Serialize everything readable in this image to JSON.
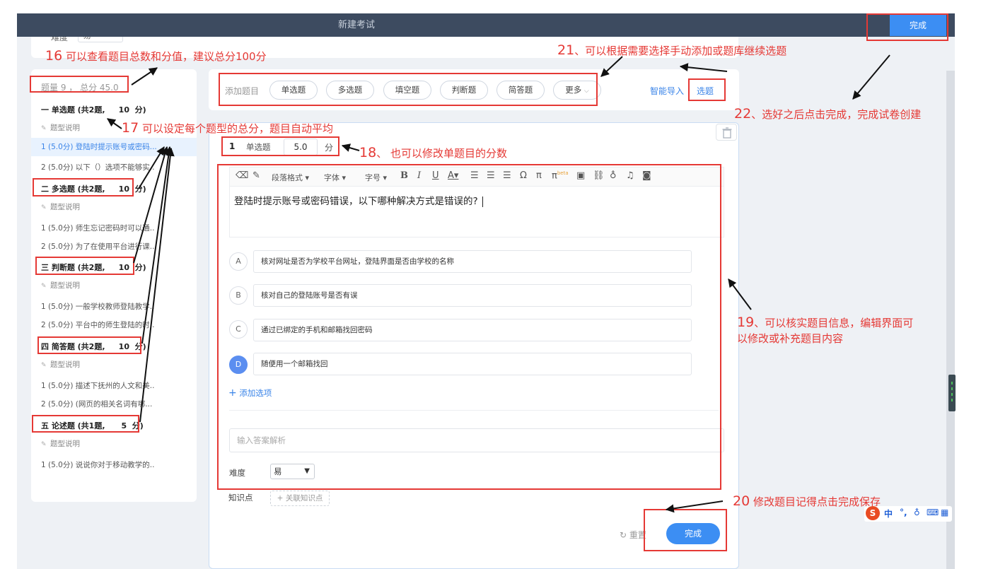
{
  "window": {
    "title": "新建考试",
    "done_label": "完成"
  },
  "prev_panel": {
    "difficulty_label": "难度",
    "difficulty_value": "易"
  },
  "sidebar": {
    "summary": "题量 9 ， 总分 45.0",
    "type_desc": "题型说明",
    "sections": [
      {
        "title": "一 单选题 (共2题,     10  分)",
        "items": [
          "1 (5.0分) 登陆时提示账号或密码...",
          "2 (5.0分) 以下（）选项不能够实..."
        ]
      },
      {
        "title": "二 多选题 (共2题,     10  分)",
        "items": [
          "1 (5.0分) 师生忘记密码时可以通...",
          "2 (5.0分) 为了在使用平台进行课..."
        ]
      },
      {
        "title": "三 判断题 (共2题,     10  分)",
        "items": [
          "1 (5.0分) 一般学校教师登陆教学...",
          "2 (5.0分) 平台中的师生登陆的时..."
        ]
      },
      {
        "title": "四 简答题 (共2题,     10  分)",
        "items": [
          "1 (5.0分) 描述下抚州的人文和美...",
          "2 (5.0分) (网页的相关名词有哪..."
        ]
      },
      {
        "title": "五 论述题 (共1题,      5  分)",
        "items": [
          "1 (5.0分) 说说你对于移动教学的..."
        ]
      }
    ]
  },
  "toolbar": {
    "label": "添加题目",
    "types": [
      "单选题",
      "多选题",
      "填空题",
      "判断题",
      "简答题",
      "更多"
    ],
    "smart_import": "智能导入",
    "pick": "选题"
  },
  "editor": {
    "q_num": "1",
    "q_type": "单选题",
    "score": "5.0",
    "score_unit": "分",
    "rte": {
      "para": "段落格式",
      "font": "字体",
      "size": "字号",
      "beta": "beta"
    },
    "question": "登陆时提示账号或密码错误，以下哪种解决方式是错误的?",
    "options": [
      {
        "letter": "A",
        "text": "核对网址是否为学校平台网址，登陆界面是否由学校的名称",
        "selected": false
      },
      {
        "letter": "B",
        "text": "核对自己的登陆账号是否有误",
        "selected": false
      },
      {
        "letter": "C",
        "text": "通过已绑定的手机和邮箱找回密码",
        "selected": false
      },
      {
        "letter": "D",
        "text": "随便用一个邮箱找回",
        "selected": true
      }
    ],
    "add_option": "添加选项",
    "analysis_placeholder": "输入答案解析",
    "difficulty_label": "难度",
    "difficulty_value": "易",
    "kp_label": "知识点",
    "kp_button": "关联知识点",
    "reset": "重置",
    "done": "完成"
  },
  "annotations": {
    "n16": {
      "num": "16",
      "text": " 可以查看题目总数和分值，建议总分100分"
    },
    "n17": {
      "num": "17",
      "text": " 可以设定每个题型的总分，题目自动平均"
    },
    "n18": {
      "num": "18",
      "text": "、 也可以修改单题目的分数"
    },
    "n19": {
      "num": "19",
      "text": "、可以核实题目信息，编辑界面可",
      "line2": "以修改或补充题目内容"
    },
    "n20": {
      "num": "20",
      "text": " 修改题目记得点击完成保存"
    },
    "n21": {
      "num": "21",
      "text": "、可以根据需要选择手动添加或题库继续选题"
    },
    "n22": {
      "num": "22",
      "text": "、选好之后点击完成，完成试卷创建"
    }
  },
  "ime": {
    "logo": "S",
    "lang": "中",
    "punct": "°,"
  },
  "colors": {
    "accent": "#3c8ef3",
    "annotation": "#e53935",
    "topbar": "#3d4b60"
  }
}
